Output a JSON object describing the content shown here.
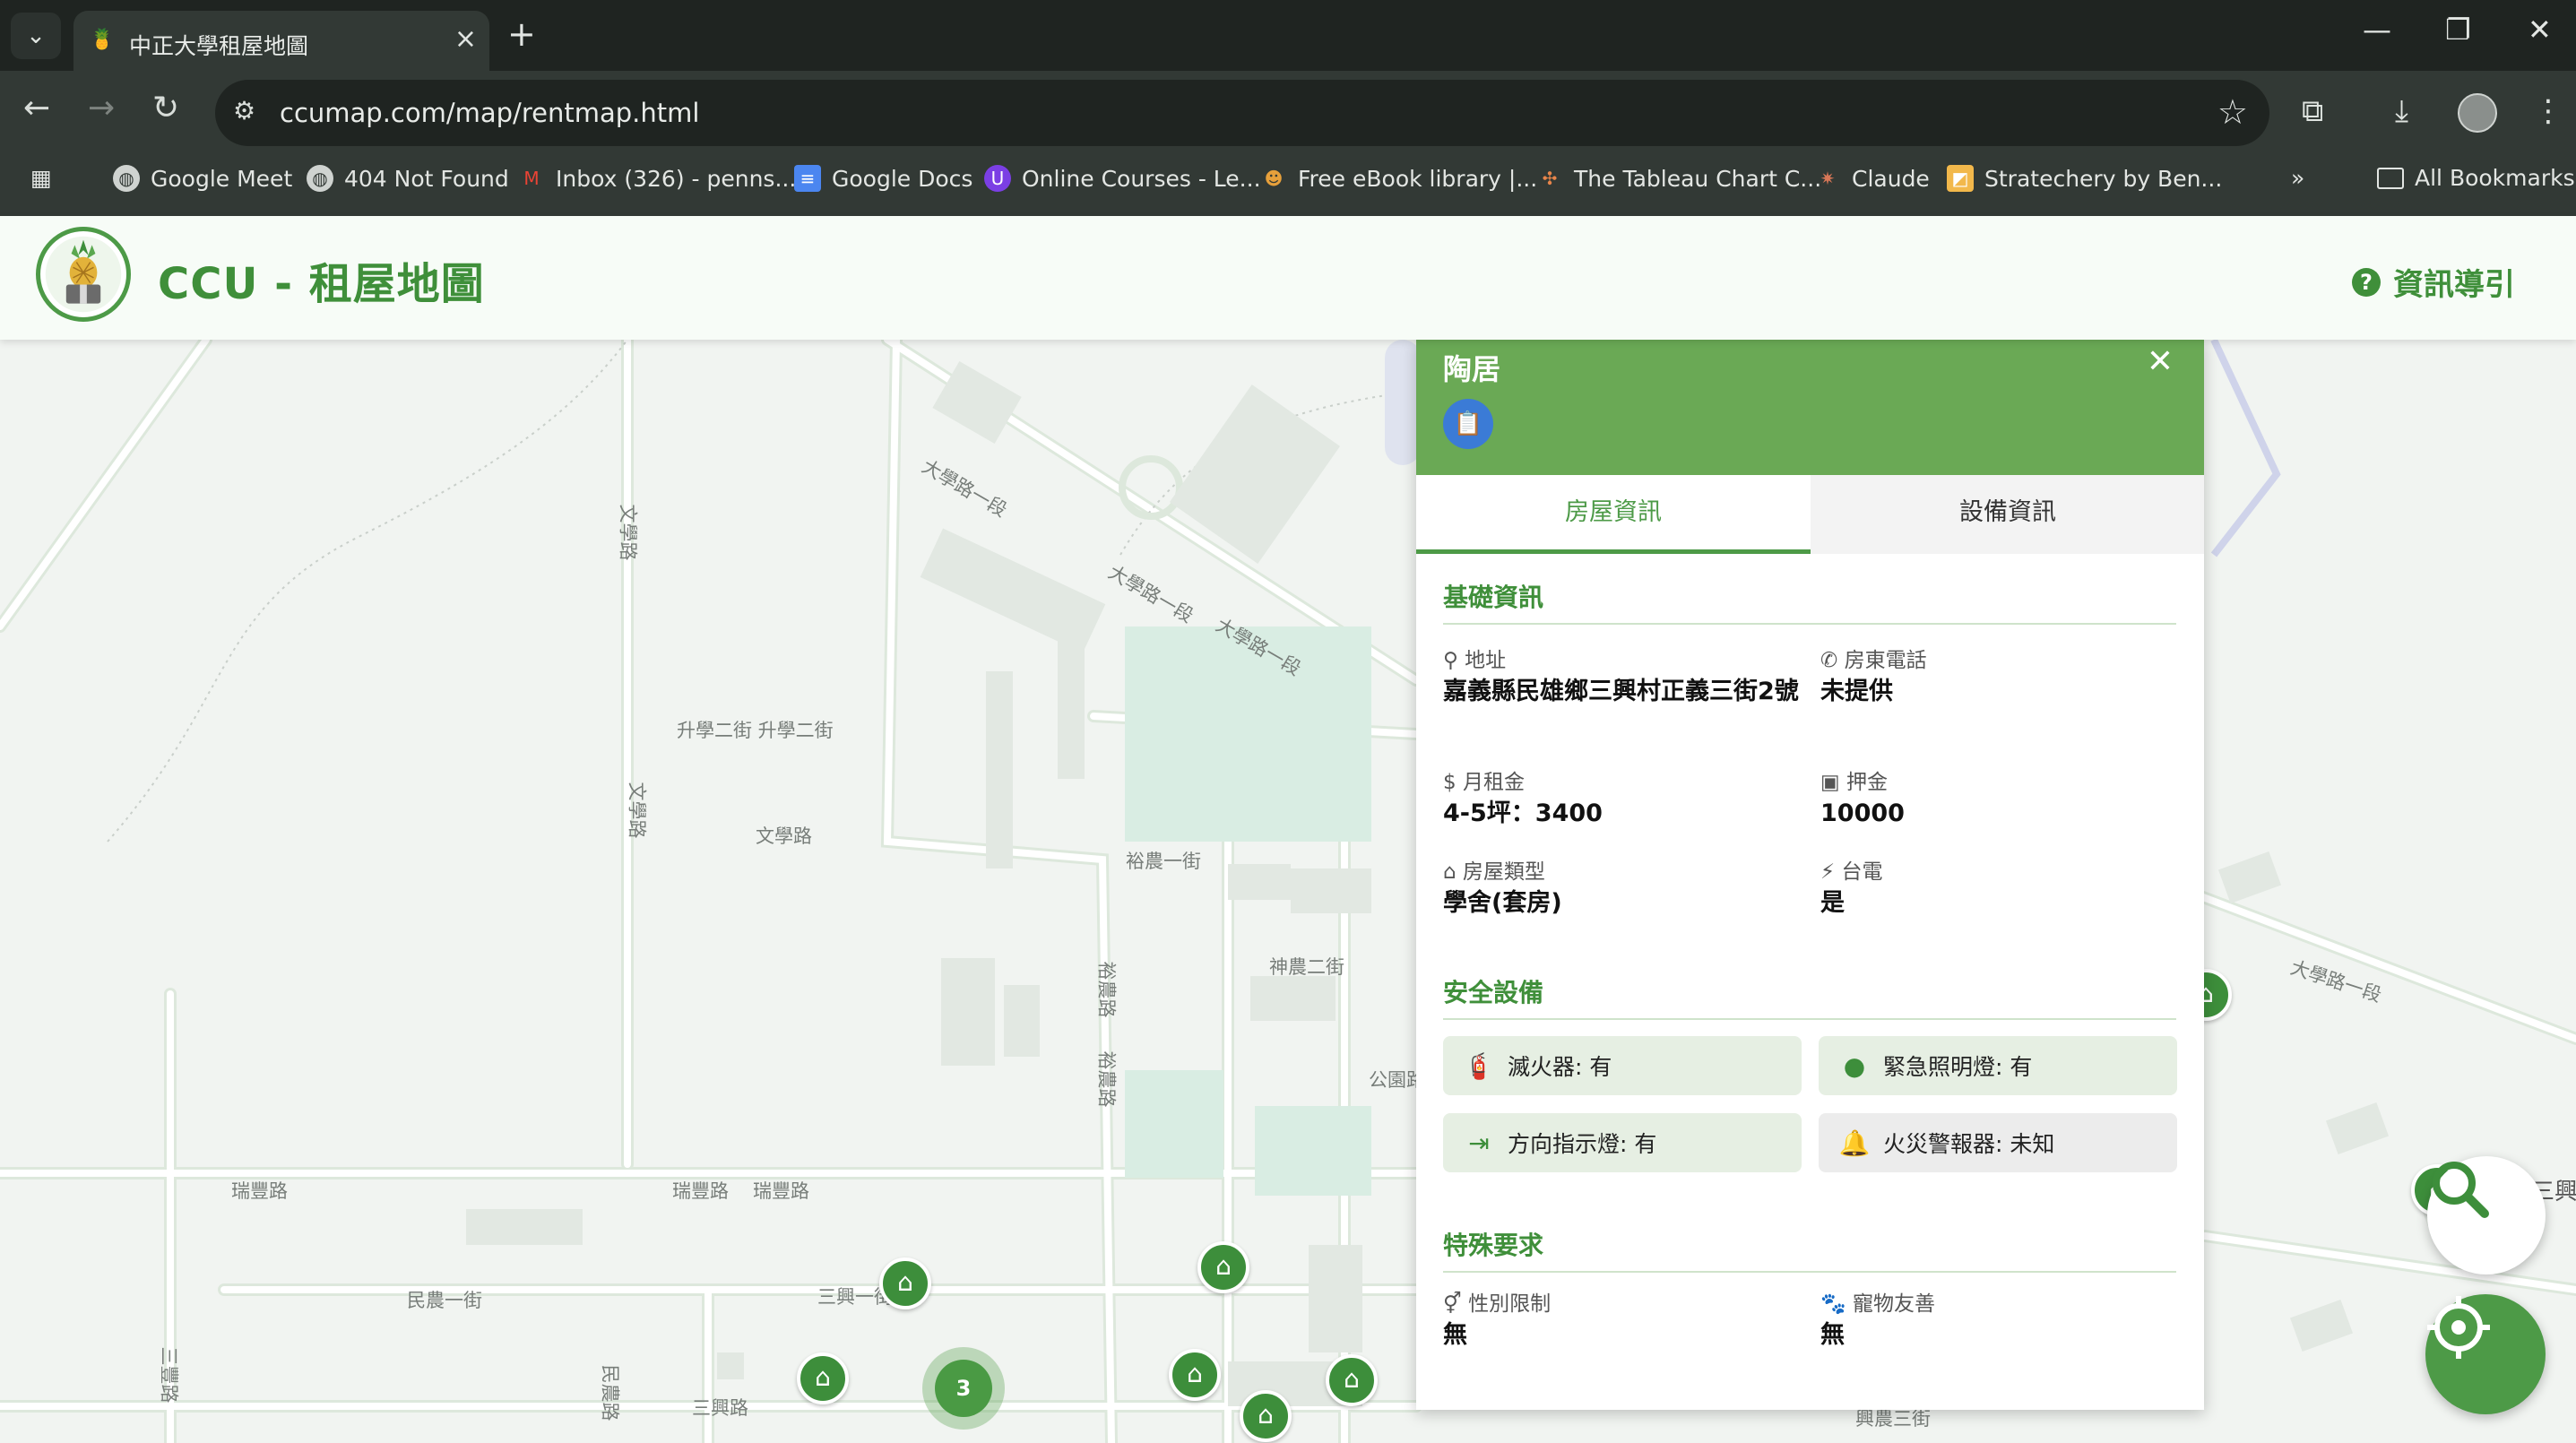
{
  "browser": {
    "tab_title": "中正大學租屋地圖",
    "url": "ccumap.com/map/rentmap.html",
    "bookmarks": [
      {
        "label": "Google Meet",
        "icon": "globe-icon"
      },
      {
        "label": "404 Not Found",
        "icon": "globe-icon"
      },
      {
        "label": "Inbox (326) - penns...",
        "icon": "gmail-icon"
      },
      {
        "label": "Google Docs",
        "icon": "docs-icon"
      },
      {
        "label": "Online Courses - Le...",
        "icon": "udemy-icon"
      },
      {
        "label": "Free eBook library |...",
        "icon": "book-icon"
      },
      {
        "label": "The Tableau Chart C...",
        "icon": "tableau-icon"
      },
      {
        "label": "Claude",
        "icon": "claude-icon"
      },
      {
        "label": "Stratechery by Ben...",
        "icon": "stratechery-icon"
      }
    ],
    "all_bookmarks": "All Bookmarks"
  },
  "app": {
    "title": "CCU - 租屋地圖",
    "guide": "資訊導引",
    "brand_color": "#3f8f3a"
  },
  "map": {
    "labels": {
      "l1": "大學路一段",
      "l2": "大學路一段",
      "l3": "大學路一段",
      "l4": "文學路",
      "l5": "升學二街 升學二街",
      "l6": "文學路",
      "l7": "文學路",
      "l8": "裕農一街",
      "l9": "神農二街",
      "l10": "公園路",
      "l11": "瑞豐路",
      "l12": "瑞豐路",
      "l13": "瑞豐路",
      "l14": "民農一街",
      "l15": "三興一街",
      "l16": "三興路",
      "l17": "大學路一段",
      "l18": "興農三街",
      "l19": "三興",
      "l20": "裕農路",
      "l21": "裕農路",
      "l22": "三豐路",
      "l23": "民農路"
    },
    "cluster_count": "3"
  },
  "panel": {
    "name": "陶居",
    "tabs": [
      "房屋資訊",
      "設備資訊"
    ],
    "basic_title": "基礎資訊",
    "fields": {
      "address_label": "地址",
      "address": "嘉義縣民雄鄉三興村正義三街2號",
      "phone_label": "房東電話",
      "phone": "未提供",
      "rent_label": "月租金",
      "rent": "4-5坪：3400",
      "deposit_label": "押金",
      "deposit": "10000",
      "type_label": "房屋類型",
      "type": "學舍(套房)",
      "power_label": "台電",
      "power": "是"
    },
    "safety_title": "安全設備",
    "safety": [
      {
        "label": "滅火器: 有",
        "icon": "fire-extinguisher-icon"
      },
      {
        "label": "緊急照明燈: 有",
        "icon": "lightbulb-icon"
      },
      {
        "label": "方向指示燈: 有",
        "icon": "exit-sign-icon"
      },
      {
        "label": "火災警報器: 未知",
        "icon": "bell-icon"
      }
    ],
    "special_title": "特殊要求",
    "special": {
      "gender_label": "性別限制",
      "gender": "無",
      "pet_label": "寵物友善",
      "pet": "無"
    }
  }
}
